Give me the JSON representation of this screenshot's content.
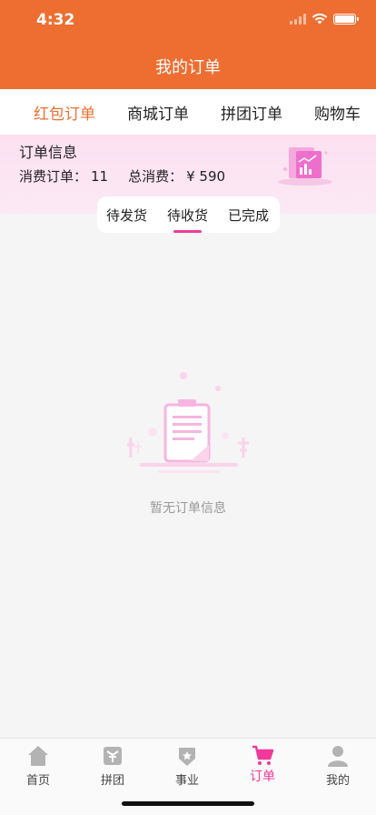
{
  "status_bar": {
    "time": "4:32"
  },
  "header": {
    "title": "我的订单"
  },
  "tabs": [
    {
      "label": "红包订单",
      "active": true
    },
    {
      "label": "商城订单",
      "active": false
    },
    {
      "label": "拼团订单",
      "active": false
    },
    {
      "label": "购物车",
      "active": false
    }
  ],
  "order_info": {
    "title": "订单信息",
    "count_label": "消费订单：",
    "count_value": "11",
    "total_label": "总消费：",
    "total_value": "¥ 590"
  },
  "subtabs": [
    {
      "label": "待发货",
      "active": false
    },
    {
      "label": "待收货",
      "active": true
    },
    {
      "label": "已完成",
      "active": false
    }
  ],
  "empty_state": {
    "text": "暂无订单信息"
  },
  "tabbar": [
    {
      "label": "首页",
      "icon": "home-icon",
      "active": false
    },
    {
      "label": "拼团",
      "icon": "group-buy-icon",
      "active": false
    },
    {
      "label": "事业",
      "icon": "career-badge-icon",
      "active": false
    },
    {
      "label": "订单",
      "icon": "cart-icon",
      "active": true
    },
    {
      "label": "我的",
      "icon": "user-icon",
      "active": false
    }
  ],
  "colors": {
    "brand_orange": "#ee6e32",
    "accent_pink": "#f0399a"
  }
}
